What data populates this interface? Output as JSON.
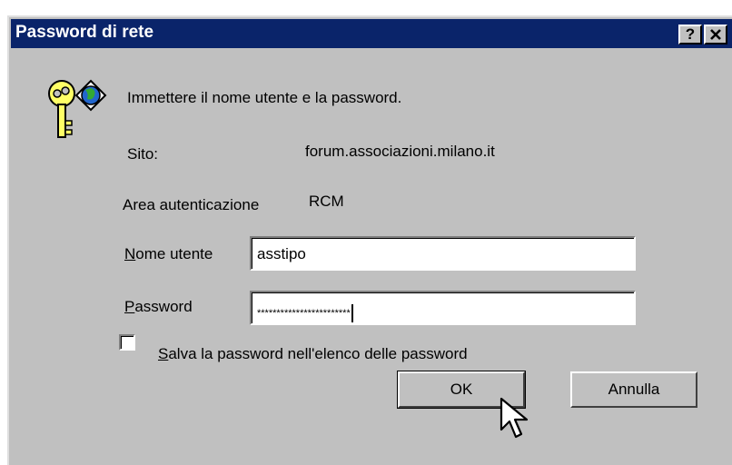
{
  "dialog": {
    "title": "Password di rete",
    "help_label": "?",
    "close_label": "✕",
    "prompt": "Immettere il nome utente e la password.",
    "site_label": "Sito:",
    "site_value": "forum.associazioni.milano.it",
    "realm_label": "Area autenticazione",
    "realm_value": "RCM",
    "username_label_first": "N",
    "username_label_rest": "ome utente",
    "username_value": "asstipo",
    "password_label_first": "P",
    "password_label_rest": "assword",
    "password_value": "************************",
    "save_label_first": "S",
    "save_label_rest": "alva la password nell'elenco delle password",
    "save_checked": false,
    "ok_label": "OK",
    "cancel_label": "Annulla"
  },
  "icons": {
    "dialog_icon": "key-globe-icon",
    "cursor": "mouse-pointer-icon"
  }
}
